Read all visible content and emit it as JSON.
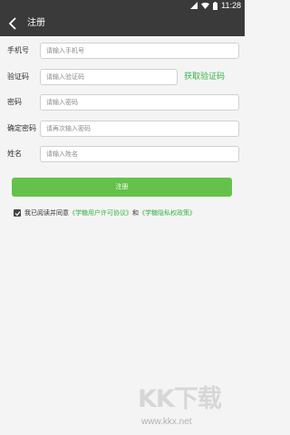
{
  "status_bar": {
    "time": "11:28",
    "icons": [
      "signal-icon",
      "wifi-icon",
      "battery-icon"
    ]
  },
  "app_bar": {
    "title": "注册",
    "back_icon": "chevron-left-icon"
  },
  "form": {
    "phone": {
      "label": "手机号",
      "placeholder": "请输入手机号",
      "value": ""
    },
    "code": {
      "label": "验证码",
      "placeholder": "请输入验证码",
      "value": "",
      "get_code_label": "获取验证码"
    },
    "password": {
      "label": "密码",
      "placeholder": "请输入密码",
      "value": ""
    },
    "confirm_password": {
      "label": "确定密码",
      "placeholder": "请再次输入密码",
      "value": ""
    },
    "name": {
      "label": "姓名",
      "placeholder": "请输入姓名",
      "value": ""
    }
  },
  "submit_label": "注册",
  "agreement": {
    "checked": true,
    "prefix": "我已阅读并同意",
    "user_agreement": "《学糖用户许可协议》",
    "conjunction": "和",
    "privacy_policy": "《学糖隐私权政策》"
  },
  "watermark": {
    "logo_text": "KK下载",
    "url": "www.kkx.net"
  },
  "colors": {
    "bar_bg": "#3a3a3a",
    "accent_green": "#37b34a",
    "button_green": "#64c24b",
    "page_bg": "#f4f4f4"
  }
}
